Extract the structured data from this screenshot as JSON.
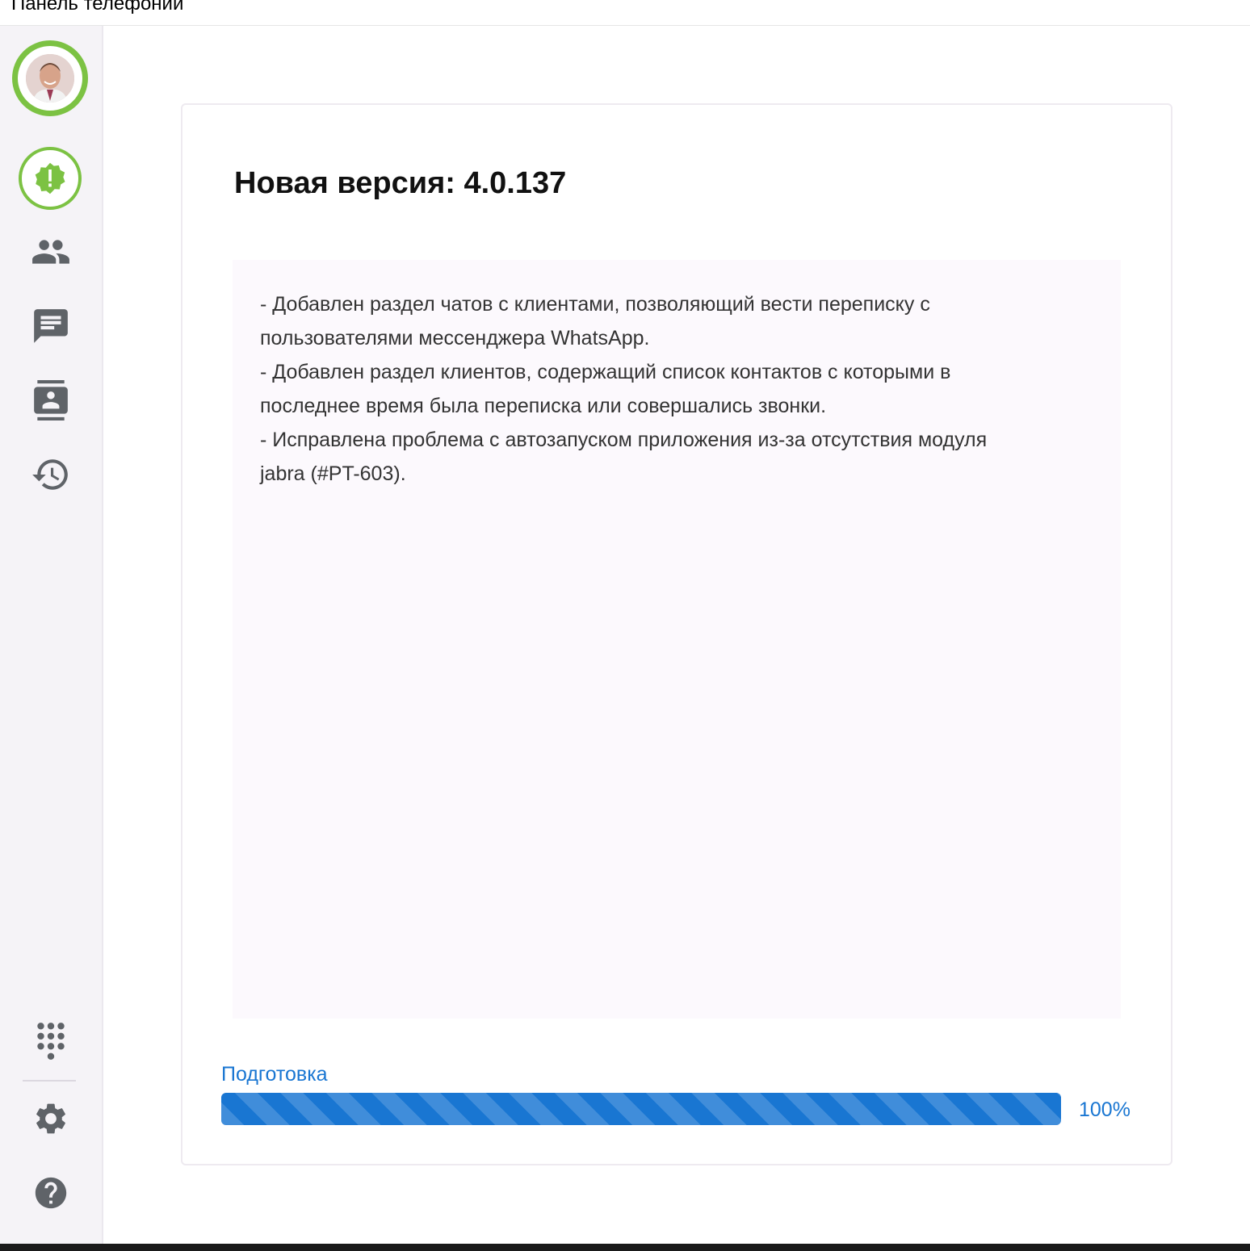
{
  "window": {
    "title": "Панель телефонии"
  },
  "sidebar": {
    "profile": {
      "icon": "user-photo",
      "status_color": "#7cc243"
    },
    "items": [
      {
        "id": "update",
        "icon": "alert-badge-icon"
      },
      {
        "id": "colleagues",
        "icon": "people-icon"
      },
      {
        "id": "chats",
        "icon": "chat-icon"
      },
      {
        "id": "contacts",
        "icon": "contact-card-icon"
      },
      {
        "id": "history",
        "icon": "history-icon"
      }
    ],
    "bottom_items": [
      {
        "id": "dialpad",
        "icon": "dialpad-icon"
      },
      {
        "id": "settings",
        "icon": "gear-icon"
      },
      {
        "id": "help",
        "icon": "help-icon"
      }
    ]
  },
  "update": {
    "title": "Новая версия: 4.0.137",
    "notes": [
      "- Добавлен раздел чатов с клиентами, позволяющий вести переписку с",
      "пользователями мессенджера WhatsApp.",
      "- Добавлен раздел клиентов, содержащий список контактов с которыми в",
      "последнее время была переписка или совершались звонки.",
      "- Исправлена проблема с автозапуском приложения из-за отсутствия модуля",
      "jabra (#PT-603)."
    ],
    "progress": {
      "label": "Подготовка",
      "value": 100,
      "value_text": "100%"
    }
  },
  "colors": {
    "accent": "#1976d2",
    "status_green": "#7cc243",
    "sidebar_bg": "#f5f3f7",
    "icon_gray": "#5f6368"
  }
}
